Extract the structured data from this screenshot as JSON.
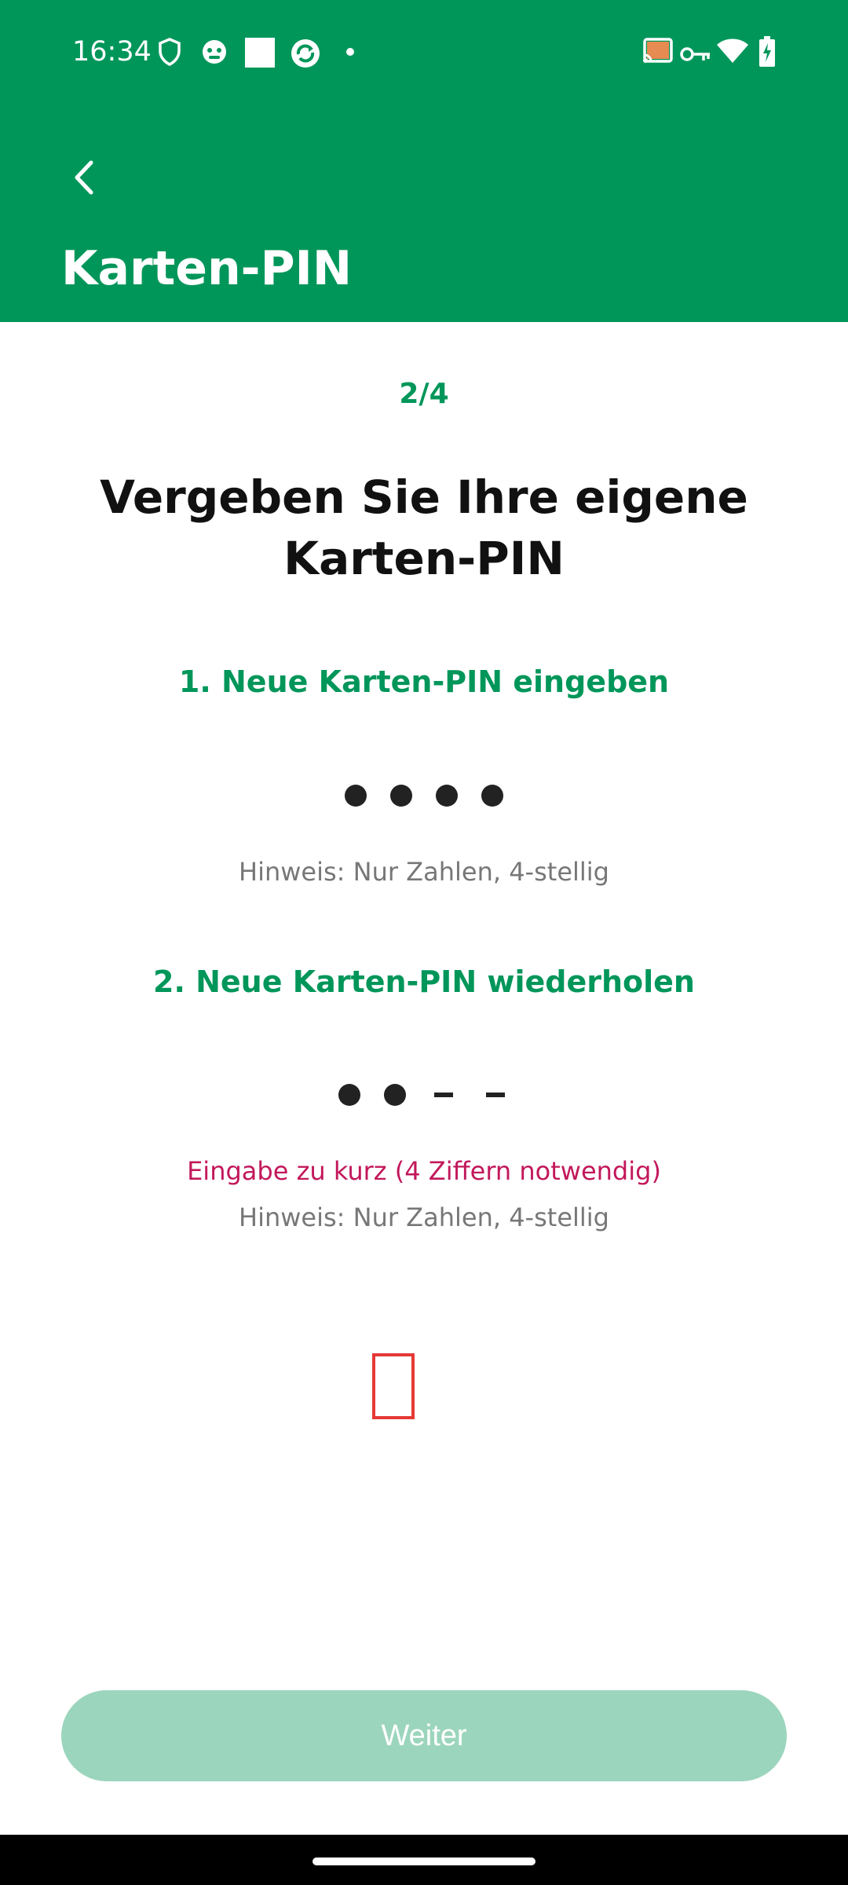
{
  "status_bar": {
    "time": "16:34",
    "left_icons": [
      "shield-icon",
      "app-face-icon",
      "square-icon",
      "sync-icon",
      "dot-icon"
    ],
    "right_icons": [
      "cast-icon",
      "vpn-key-icon",
      "wifi-icon",
      "battery-charging-icon"
    ]
  },
  "app_bar": {
    "back_icon": "chevron-left-icon",
    "title": "Karten-PIN",
    "background_color": "#00965a"
  },
  "main": {
    "step": "2/4",
    "heading": "Vergeben Sie Ihre eigene Karten-PIN",
    "section1": {
      "title": "1. Neue Karten-PIN eingeben",
      "pin_entered": 4,
      "pin_length": 4,
      "hint": "Hinweis: Nur Zahlen, 4-stellig"
    },
    "section2": {
      "title": "2. Neue Karten-PIN wiederholen",
      "pin_entered": 2,
      "pin_length": 4,
      "error": "Eingabe zu kurz (4 Ziffern notwendig)",
      "hint": "Hinweis: Nur Zahlen, 4-stellig"
    }
  },
  "footer": {
    "button_label": "Weiter",
    "button_color": "#9cd5bd"
  },
  "colors": {
    "accent": "#00965a",
    "error": "#c2185b"
  }
}
